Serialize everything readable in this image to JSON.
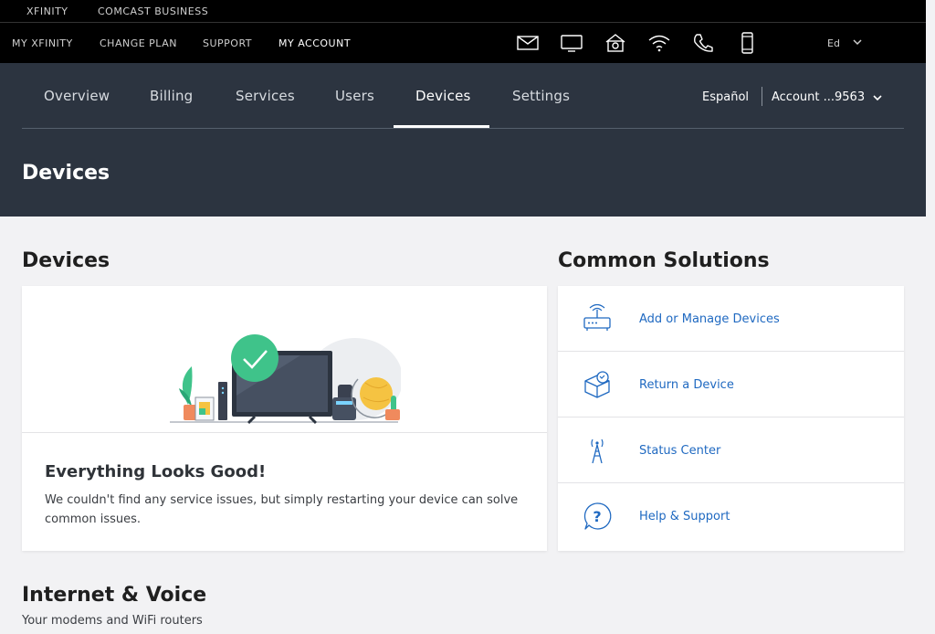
{
  "top_bar": {
    "xfinity": "XFINITY",
    "comcast_business": "COMCAST BUSINESS"
  },
  "global_nav": {
    "links": [
      "MY XFINITY",
      "CHANGE PLAN",
      "SUPPORT",
      "MY ACCOUNT"
    ],
    "active_link": "MY ACCOUNT",
    "icons": [
      "mail-icon",
      "tv-icon",
      "home-security-icon",
      "wifi-icon",
      "phone-icon",
      "mobile-icon"
    ],
    "user_initials": "Ed"
  },
  "header": {
    "tabs": [
      "Overview",
      "Billing",
      "Services",
      "Users",
      "Devices",
      "Settings"
    ],
    "active_tab": "Devices",
    "language_link": "Español",
    "account_label": "Account ...9563",
    "page_title": "Devices"
  },
  "devices_section": {
    "title": "Devices",
    "status_title": "Everything Looks Good!",
    "status_text": "We couldn't find any service issues, but simply restarting your device can solve common issues."
  },
  "solutions_section": {
    "title": "Common Solutions",
    "items": [
      {
        "label": "Add or Manage Devices",
        "icon": "router-icon"
      },
      {
        "label": "Return a Device",
        "icon": "return-box-icon"
      },
      {
        "label": "Status Center",
        "icon": "signal-tower-icon"
      },
      {
        "label": "Help & Support",
        "icon": "help-question-icon"
      }
    ]
  },
  "internet_section": {
    "title": "Internet & Voice",
    "subtitle": "Your modems and WiFi routers"
  },
  "colors": {
    "header_bg": "#2c3440",
    "nav_bg": "#000000",
    "link_blue": "#1f69c1",
    "success_green": "#3fc38a"
  }
}
